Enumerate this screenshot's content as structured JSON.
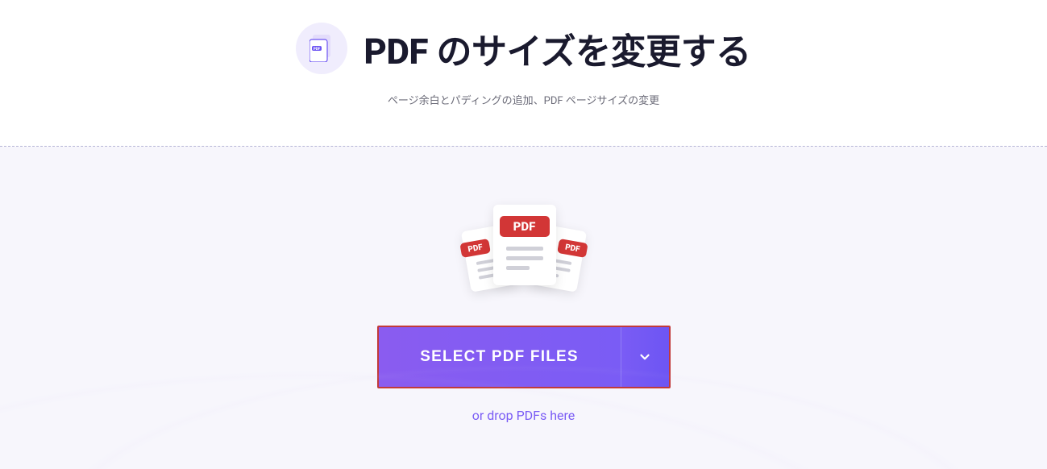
{
  "header": {
    "title": "PDF のサイズを変更する",
    "subtitle": "ページ余白とパディングの追加、PDF ページサイズの変更"
  },
  "pdf_badge_label": "PDF",
  "upload": {
    "select_label": "SELECT PDF FILES",
    "drop_hint": "or drop PDFs here"
  }
}
